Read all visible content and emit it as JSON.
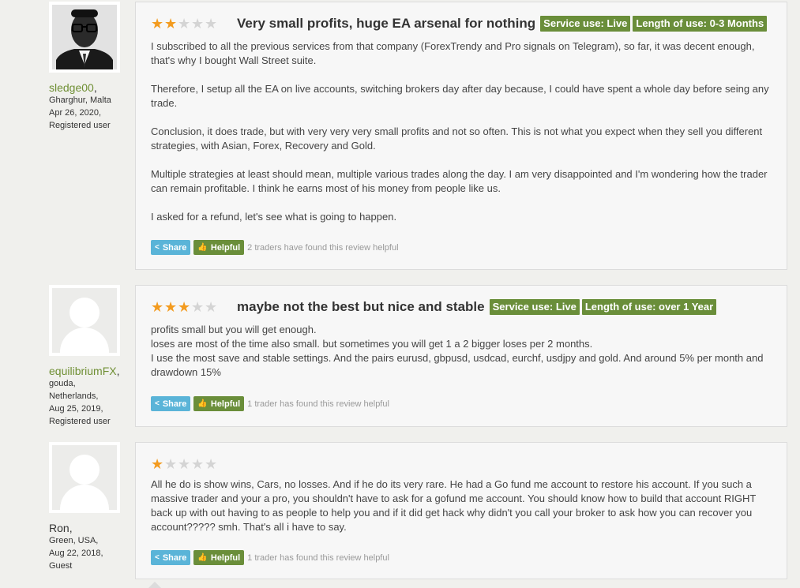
{
  "reviews": [
    {
      "user": {
        "name": "sledge00",
        "location": "Gharghur, Malta",
        "date": "Apr 26, 2020,",
        "status": "Registered user"
      },
      "rating": 2,
      "title": "Very small profits, huge EA arsenal for nothing",
      "tags": [
        "Service use: Live",
        "Length of use: 0-3 Months"
      ],
      "paragraphs": [
        "I subscribed to all the previous services from that company (ForexTrendy and Pro signals on Telegram), so far, it was decent enough, that's why I bought Wall Street suite.",
        "Therefore, I setup all the EA on live accounts, switching brokers day after day because, I could have spent a whole day before seing any trade.",
        "Conclusion, it does trade, but with very very very small profits and not so often. This is not what you expect when they sell you different strategies, with Asian, Forex, Recovery and Gold.",
        "Multiple strategies at least should mean, multiple various trades along the day. I am very disappointed and I'm wondering how the trader can remain profitable. I think he earns most of his money from people like us.",
        "I asked for a refund, let's see what is going to happen."
      ],
      "share_label": "Share",
      "helpful_label": "Helpful",
      "helpful_note": "2 traders have found this review helpful"
    },
    {
      "user": {
        "name": "equilibriumFX",
        "location1": "gouda,",
        "location2": "Netherlands,",
        "date": "Aug 25, 2019,",
        "status": "Registered user"
      },
      "rating": 3,
      "title": "maybe not the best but nice and stable",
      "tags": [
        "Service use: Live",
        "Length of use: over 1 Year"
      ],
      "lines": [
        "profits small but you will get enough.",
        "loses are most of the time also small. but sometimes you will get 1 a 2 bigger loses per 2 months.",
        "I use the most save and stable settings. And the pairs eurusd, gbpusd, usdcad, eurchf, usdjpy and gold. And around 5% per month and drawdown 15%"
      ],
      "share_label": "Share",
      "helpful_label": "Helpful",
      "helpful_note": "1 trader has found this review helpful"
    },
    {
      "user": {
        "name": "Ron",
        "location": "Green, USA,",
        "date": "Aug 22, 2018,",
        "status": "Guest"
      },
      "rating": 1,
      "text": "All he do is show wins, Cars, no losses. And if he do its very rare. He had a Go fund me account to restore his account. If you such a massive trader and your a pro, you shouldn't have to ask for a gofund me account. You should know how to build that account RIGHT back up with out having to as people to help you and if it did get hack why didn't you call your broker to ask how you can recover you account????? smh. That's all i have to say.",
      "share_label": "Share",
      "helpful_label": "Helpful",
      "helpful_note": "1 trader has found this review helpful"
    }
  ],
  "colors": {
    "accent_green": "#6a8e3a",
    "share_blue": "#5ab4d8",
    "star_orange": "#f39b1f"
  }
}
